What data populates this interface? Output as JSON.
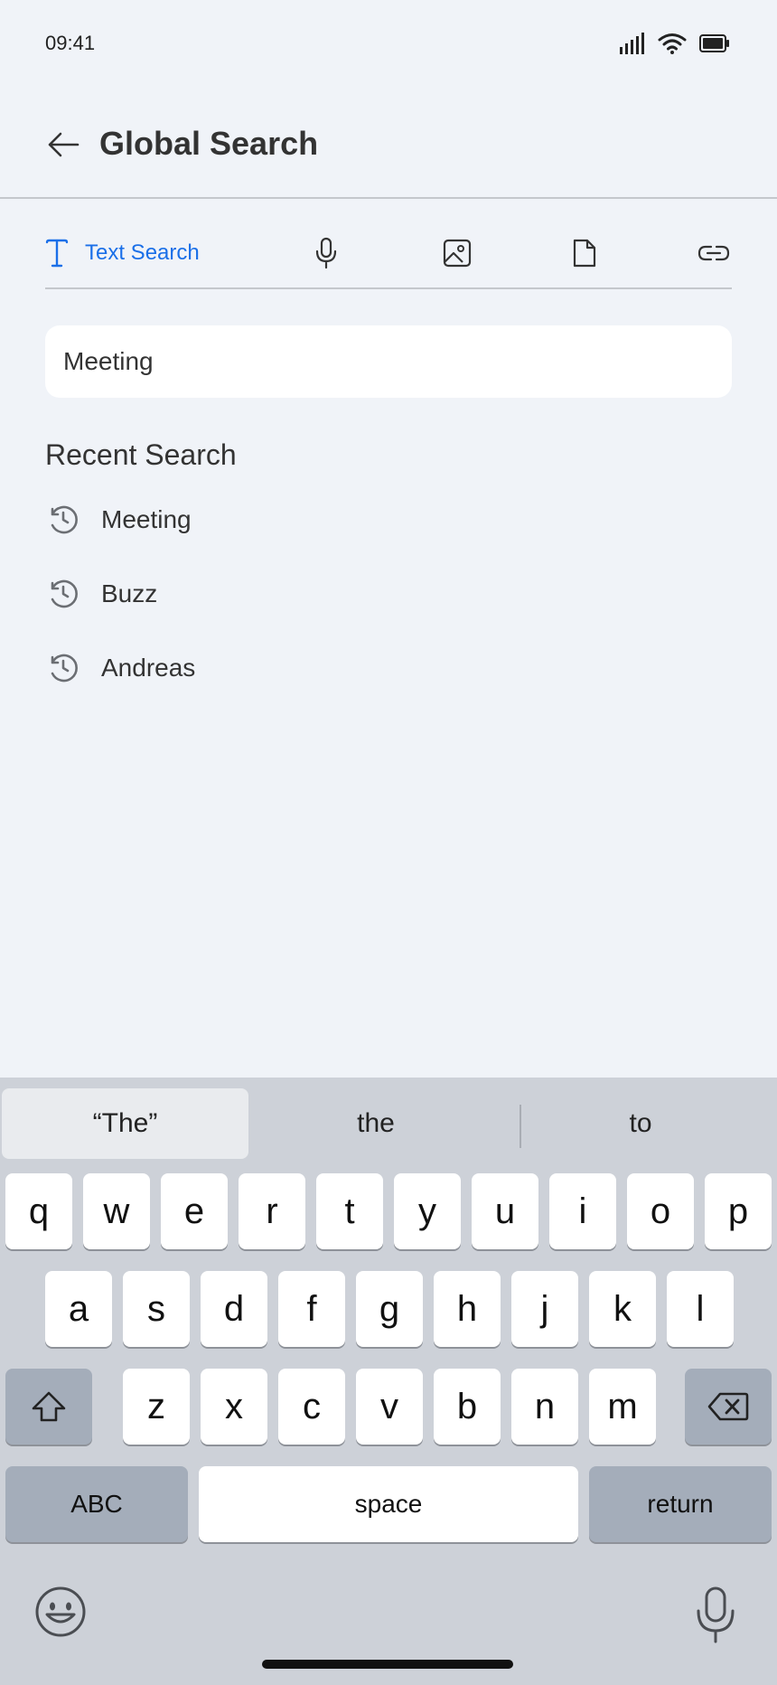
{
  "status_bar": {
    "time": "09:41",
    "icons": [
      "signal-icon",
      "wifi-icon",
      "battery-icon"
    ]
  },
  "header": {
    "title": "Global Search",
    "back_icon": "back-arrow-icon"
  },
  "tabs": [
    {
      "id": "text",
      "label": "Text Search",
      "icon": "text-icon",
      "active": true
    },
    {
      "id": "voice",
      "label": "",
      "icon": "microphone-icon",
      "active": false
    },
    {
      "id": "image",
      "label": "",
      "icon": "image-icon",
      "active": false
    },
    {
      "id": "file",
      "label": "",
      "icon": "file-icon",
      "active": false
    },
    {
      "id": "link",
      "label": "",
      "icon": "link-icon",
      "active": false
    }
  ],
  "search": {
    "value": "Meeting"
  },
  "recent": {
    "title": "Recent Search",
    "items": [
      "Meeting",
      "Buzz",
      "Andreas"
    ]
  },
  "keyboard": {
    "suggestions": [
      "“The”",
      "the",
      "to"
    ],
    "row1": [
      "q",
      "w",
      "e",
      "r",
      "t",
      "y",
      "u",
      "i",
      "o",
      "p"
    ],
    "row2": [
      "a",
      "s",
      "d",
      "f",
      "g",
      "h",
      "j",
      "k",
      "l"
    ],
    "row3": [
      "z",
      "x",
      "c",
      "v",
      "b",
      "n",
      "m"
    ],
    "abc_label": "ABC",
    "space_label": "space",
    "return_label": "return"
  },
  "colors": {
    "accent": "#1a6fe8",
    "background": "#f0f3f8",
    "keyboard_bg": "#cdd1d8"
  }
}
